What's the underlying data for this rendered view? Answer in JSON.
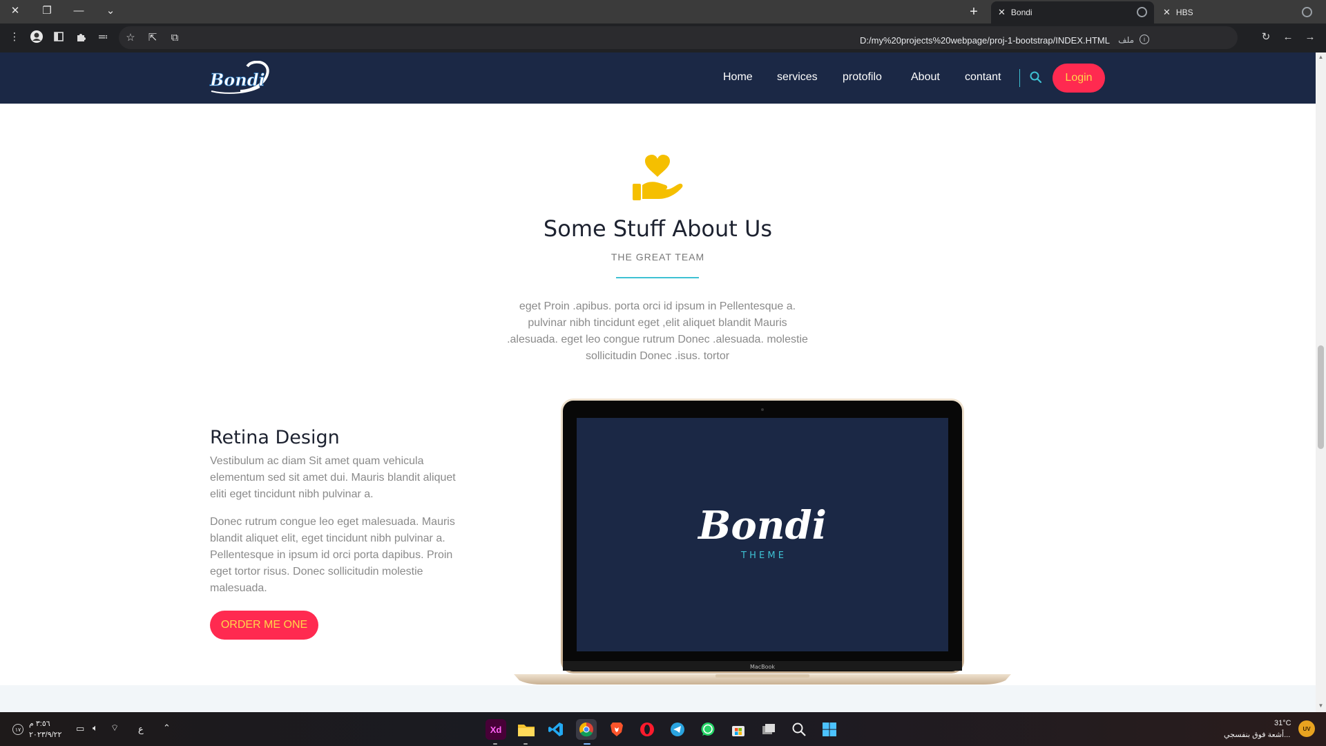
{
  "browser": {
    "tabs": [
      {
        "title": "Bondi",
        "active": true
      },
      {
        "title": "HBS",
        "active": false
      }
    ],
    "url": "D:/my%20projects%20webpage/proj-1-bootstrap/INDEX.HTML",
    "url_label": "ملف"
  },
  "navbar": {
    "logo_text": "Bondi",
    "links": [
      "Home",
      "services",
      "protofilo",
      "About",
      "contant"
    ],
    "login_label": "Login"
  },
  "about": {
    "title": "Some Stuff About Us",
    "subtitle": "THE GREAT TEAM",
    "text_lines": [
      "eget Proin .apibus. porta orci id ipsum in Pellentesque a.",
      "pulvinar nibh tincidunt eget ,elit aliquet blandit Mauris",
      ".alesuada. eget leo congue rutrum Donec .alesuada. molestie",
      "sollicitudin Donec .isus. tortor"
    ]
  },
  "retina": {
    "title": "Retina Design",
    "para1_lines": [
      "Vestibulum ac diam Sit amet quam vehicula",
      "elementum sed sit amet dui. Mauris blandit aliquet",
      "eliti eget tincidunt nibh pulvinar a."
    ],
    "para2_lines": [
      "Donec rutrum congue leo eget malesuada. Mauris",
      "blandit aliquet elit, eget tincidunt nibh pulvinar a.",
      "Pellentesque in ipsum id orci porta dapibus. Proin",
      "eget tortor risus. Donec sollicitudin molestie",
      "malesuada."
    ],
    "button_label": "ORDER ME ONE"
  },
  "laptop": {
    "screen_logo": "Bondi",
    "screen_tagline": "T H E M E",
    "brand_label": "MacBook"
  },
  "taskbar": {
    "time": "٣:٥٦ م",
    "date": "٢٠٢٣/٩/٢٢",
    "lang": "ع",
    "notif_count": "١٧",
    "weather_temp": "31°C",
    "weather_desc": "أشعة فوق بنفسجي...",
    "weather_badge": "UV"
  },
  "colors": {
    "navy": "#1b2845",
    "accent_red": "#ff2a50",
    "accent_yellow": "#ffd74a",
    "accent_cyan": "#3ec1d3",
    "icon_yellow": "#f5bf00"
  }
}
